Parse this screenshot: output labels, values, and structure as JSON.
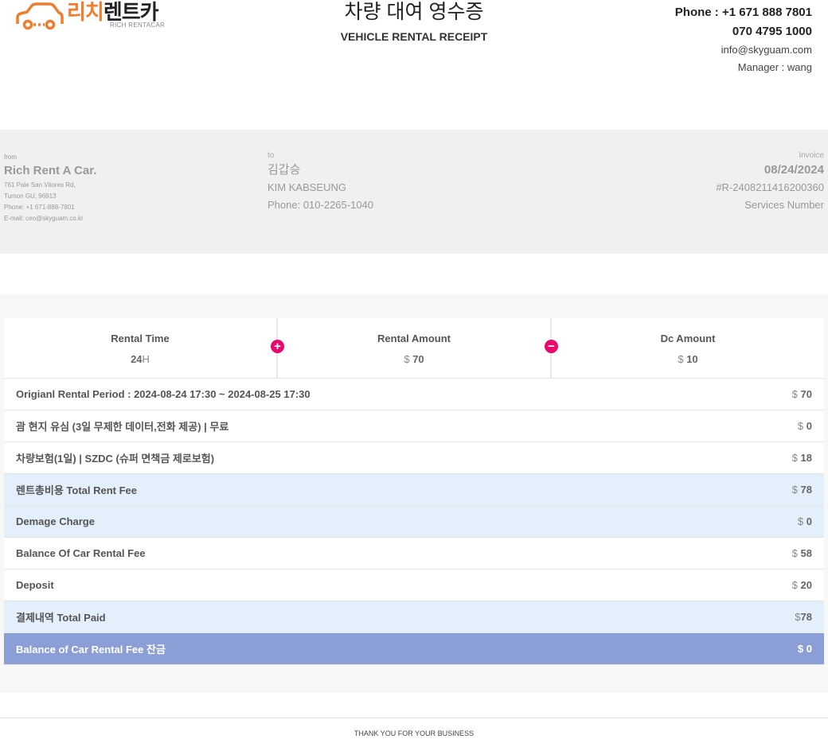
{
  "brand": {
    "name_ko_part1": "리치",
    "name_ko_part2": "렌트카",
    "name_en": "RICH RENTACAR",
    "accent_color": "#f07c2c"
  },
  "title": {
    "ko": "차량 대여 영수증",
    "en": "VEHICLE RENTAL RECEIPT"
  },
  "contact": {
    "phone": "Phone : +1 671 888 7801",
    "phone2": "070 4795 1000",
    "email": "info@skyguam.com",
    "manager": "Manager : wang"
  },
  "from": {
    "label": "from",
    "name": "Rich Rent A Car.",
    "address1": "761 Pale San Vitores Rd,",
    "address2": "Tumon GU, 96913",
    "phone": "Phone: +1 671-888-7801",
    "email": "E-mail: ceo@skyguam.co.kr"
  },
  "to": {
    "label": "to",
    "name_ko": "김갑승",
    "name_en": "KIM KABSEUNG",
    "phone": "Phone: 010-2265-1040"
  },
  "invoice": {
    "label": "Invoice",
    "date": "08/24/2024",
    "number": "#R-2408211416200360",
    "services": "Services Number"
  },
  "summary": {
    "rental_time": {
      "header": "Rental Time",
      "value": "24",
      "unit": "H"
    },
    "rental_amount": {
      "header": "Rental Amount",
      "currency": "$",
      "value": "70"
    },
    "dc_amount": {
      "header": "Dc Amount",
      "currency": "$",
      "value": "10"
    },
    "plus_symbol": "+",
    "minus_symbol": "−",
    "symbol_color": "#e8086b"
  },
  "rows": [
    {
      "label": "Origianl Rental Period : 2024-08-24 17:30 ~ 2024-08-25 17:30",
      "currency": "$",
      "amount": "70"
    },
    {
      "label": "괌 현지 유심 (3일 무제한 데이터,전화 제공) | 무료",
      "currency": "$",
      "amount": "0"
    },
    {
      "label": "차량보험(1일) | SZDC (슈퍼 면책금 제로보험)",
      "currency": "$",
      "amount": "18"
    },
    {
      "label": "렌트총비용 Total Rent Fee",
      "currency": "$",
      "amount": "78"
    },
    {
      "label": "Demage Charge",
      "currency": "$",
      "amount": "0"
    },
    {
      "label": "Balance Of Car Rental Fee",
      "currency": "$",
      "amount": "58"
    },
    {
      "label": "Deposit",
      "currency": "$",
      "amount": "20"
    },
    {
      "label": "결제내역 Total Paid",
      "currency": "$",
      "amount": "78"
    },
    {
      "label": "Balance of Car Rental Fee 잔금",
      "currency": "$",
      "amount": "0"
    }
  ],
  "colors": {
    "highlight_row": "#e3effb",
    "total_row": "#8b9fd6"
  },
  "footer": {
    "text": "THANK YOU FOR YOUR BUSINESS"
  }
}
